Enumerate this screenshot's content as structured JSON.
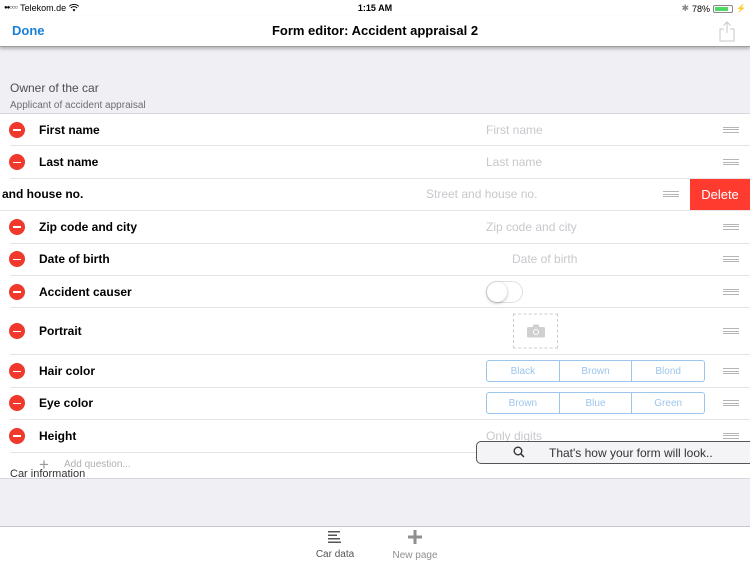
{
  "status_bar": {
    "carrier": "Telekom.de",
    "signal_bars": "●●○○○",
    "time": "1:15 AM",
    "battery_percent": "78%",
    "battery_level": 0.78
  },
  "nav": {
    "done_label": "Done",
    "title": "Form editor: Accident appraisal 2"
  },
  "section": {
    "title": "Owner of the car",
    "subtitle": "Applicant of accident appraisal"
  },
  "rows": [
    {
      "label": "First name",
      "type": "text",
      "placeholder": "First name"
    },
    {
      "label": "Last name",
      "type": "text",
      "placeholder": "Last name"
    },
    {
      "label": "Street and house no.",
      "type": "text",
      "placeholder": "Street and house no.",
      "swiped": true,
      "visible_label": "et and house no."
    },
    {
      "label": "Zip code and city",
      "type": "text",
      "placeholder": "Zip code and city"
    },
    {
      "label": "Date of birth",
      "type": "date",
      "placeholder": "Date of birth"
    },
    {
      "label": "Accident causer",
      "type": "toggle",
      "value": false
    },
    {
      "label": "Portrait",
      "type": "photo"
    },
    {
      "label": "Hair color",
      "type": "segmented",
      "options": [
        "Black",
        "Brown",
        "Blond"
      ]
    },
    {
      "label": "Eye color",
      "type": "segmented",
      "options": [
        "Brown",
        "Blue",
        "Green"
      ]
    },
    {
      "label": "Height",
      "type": "number",
      "placeholder": "Only digits"
    }
  ],
  "delete_label": "Delete",
  "add_question_label": "Add question...",
  "preview_label": "That's how your form will look..",
  "next_section_title": "Car information",
  "tabs": [
    {
      "label": "Car data",
      "icon": "list-icon",
      "active": true
    },
    {
      "label": "New page",
      "icon": "plus-icon",
      "active": false
    }
  ],
  "colors": {
    "accent": "#1a80d6",
    "delete_red": "#ff3b30",
    "minus_red": "#f0392d",
    "segment_blue": "#9cc5ec",
    "battery_green": "#4cd964"
  }
}
